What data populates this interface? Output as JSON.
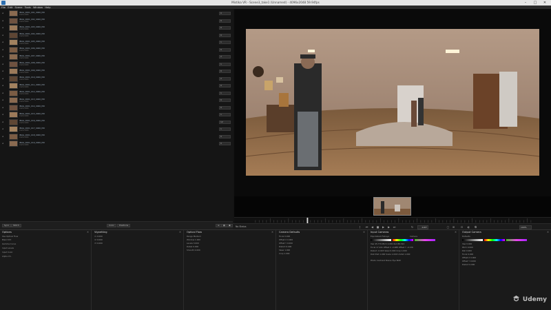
{
  "window": {
    "title": "Mistika VR - Scene3_take1 (Unnamed) - 4096x2048 59.94fps"
  },
  "menu": [
    "File",
    "Edit",
    "Scene",
    "Tools",
    "Window",
    "Help"
  ],
  "clips": [
    {
      "name": "IMAG_0001_001_0000_PW",
      "meta": "1920x1080",
      "value": "0"
    },
    {
      "name": "IMAG_0001_002_0000_PW",
      "meta": "1920x1080",
      "value": "0"
    },
    {
      "name": "IMAG_0001_003_0000_PW",
      "meta": "1920x1080",
      "value": "0"
    },
    {
      "name": "IMAG_0001_004_0000_PW",
      "meta": "1920x1080",
      "value": "0"
    },
    {
      "name": "IMAG_0001_005_0000_PW",
      "meta": "1920x1080",
      "value": "1"
    },
    {
      "name": "IMAG_0001_006_0000_PW",
      "meta": "1920x1080",
      "value": "0"
    },
    {
      "name": "IMAG_0001_007_0000_PW",
      "meta": "1920x1080",
      "value": "2"
    },
    {
      "name": "IMAG_0001_008_0000_PW",
      "meta": "1920x1080",
      "value": "1"
    },
    {
      "name": "IMAG_0001_009_0000_PW",
      "meta": "1920x1080",
      "value": "0"
    },
    {
      "name": "IMAG_0001_010_0000_PW",
      "meta": "1920x1080",
      "value": "2"
    },
    {
      "name": "IMAG_0001_011_0000_PW",
      "meta": "1920x1080",
      "value": "0"
    },
    {
      "name": "IMAG_0001_012_0000_PW",
      "meta": "1920x1080",
      "value": "1"
    },
    {
      "name": "IMAG_0001_013_0000_PW",
      "meta": "1920x1080",
      "value": "0"
    },
    {
      "name": "IMAG_0001_014_0000_PW",
      "meta": "1920x1080",
      "value": "0"
    },
    {
      "name": "IMAG_0001_015_0000_PW",
      "meta": "1920x1080",
      "value": "1"
    },
    {
      "name": "IMAG_0001_016_0000_PW",
      "meta": "1920x1080",
      "value": "12"
    },
    {
      "name": "IMAG_0001_017_0000_PW",
      "meta": "1920x1080",
      "value": "1"
    },
    {
      "name": "IMAG_0001_018_0000_PW",
      "meta": "1920x1080",
      "value": "0"
    },
    {
      "name": "IMAG_0001_019_0000_PW",
      "meta": "1920x1080",
      "value": "0"
    }
  ],
  "browser_footer": {
    "sync": "Sync",
    "stitch": "Stitch",
    "color": "Color",
    "positions": "Positions"
  },
  "transport": {
    "status": "No Status",
    "frame": "2187",
    "zoom": "100%"
  },
  "panels": {
    "options": {
      "title": "Options",
      "rows": [
        "Use Optical Flow",
        "Blend Pct",
        "Gamma Curve",
        "Input Levels",
        "Input Color",
        "Alpha Ch."
      ]
    },
    "vignetting": {
      "title": "Vignetting",
      "rows": [
        "r1 0.000",
        "r2 0.000",
        "r3 0.000"
      ]
    },
    "optical_flow": {
      "title": "Optical Flow",
      "rows": [
        "Range Medium",
        "Window 1.000",
        "Levels 3.000",
        "Detail 0.000",
        "Smooth 0.000"
      ]
    },
    "camera_defaults": {
      "title": "Camera Defaults",
      "rows": [
        "Focal 0.000",
        "Offset X 0.000",
        "Offset Y 0.000",
        "Distort 0.000",
        "Skew 1.000",
        "Crop 1.000"
      ]
    },
    "input_cameras": {
      "title": "Input Cameras",
      "mapping": "Equidistant Fisheye",
      "camera": "Camera",
      "rows": [
        "Yaw 45.779   Pitch 2.081   Roll 88.322",
        "Focal 17.241   Offset X -0.988   Offset Y -0.136",
        "Distort -0.045   Skew 0.000   Crop 1.000",
        "Dist Mult 1.000   Scale 1.000   Undist 1.000",
        "Photo Contrast   Stereo Eye Both"
      ]
    },
    "output_camera": {
      "title": "Output Camera",
      "mapping": "Defaults",
      "rows": [
        "Yaw 0.000",
        "Pitch 0.000",
        "Roll 0.000",
        "Focal 0.000",
        "Offset X 0.000",
        "Offset Y 0.000",
        "Distort 0.000"
      ]
    }
  },
  "watermark": "Udemy",
  "colors": {
    "accent": "#2d6fb0",
    "panel": "#1a1a1a",
    "background": "#141414"
  }
}
